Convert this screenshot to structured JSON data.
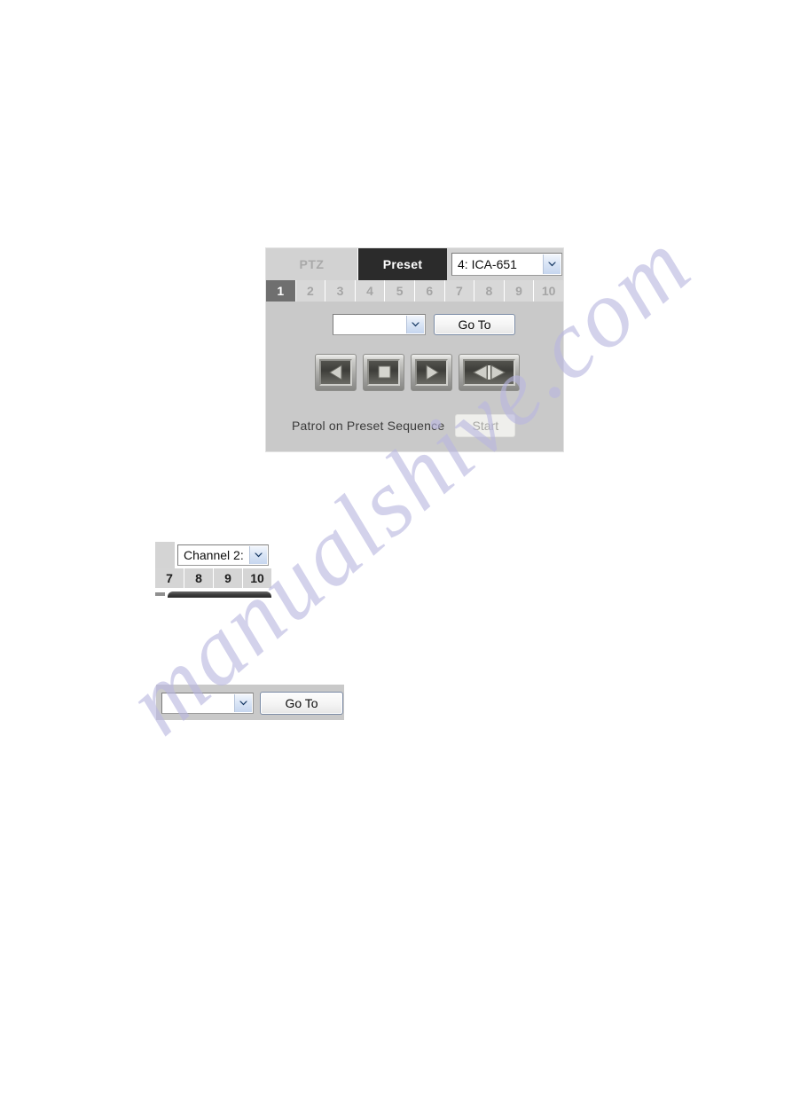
{
  "page": {
    "background_color": "#ffffff",
    "watermark_text": "manualshive.com",
    "watermark_color": "#b9b7e0"
  },
  "ptz_preset_panel": {
    "tabs": [
      {
        "label": "PTZ",
        "state": "inactive"
      },
      {
        "label": "Preset",
        "state": "active"
      }
    ],
    "camera_select": {
      "value": "4: ICA-651",
      "placeholder": "4: ICA-651"
    },
    "preset_numbers": [
      {
        "label": "1",
        "selected": true
      },
      {
        "label": "2",
        "selected": false
      },
      {
        "label": "3",
        "selected": false
      },
      {
        "label": "4",
        "selected": false
      },
      {
        "label": "5",
        "selected": false
      },
      {
        "label": "6",
        "selected": false
      },
      {
        "label": "7",
        "selected": false
      },
      {
        "label": "8",
        "selected": false
      },
      {
        "label": "9",
        "selected": false
      },
      {
        "label": "10",
        "selected": false
      }
    ],
    "preset_select": {
      "value": "",
      "placeholder": ""
    },
    "goto_button": "Go To",
    "ptz_buttons": [
      {
        "icon": "arrow-left-icon",
        "name": "pan-left-button"
      },
      {
        "icon": "stop-square-icon",
        "name": "stop-button"
      },
      {
        "icon": "arrow-right-icon",
        "name": "pan-right-button"
      },
      {
        "icon": "auto-pan-icon",
        "name": "auto-pan-button"
      }
    ],
    "patrol_label": "Patrol on Preset Sequence",
    "patrol_button": {
      "label": "Start",
      "enabled": false
    }
  },
  "channel_fragment": {
    "channel_select": {
      "value": "Channel 2:",
      "placeholder": "Channel 2:"
    },
    "numbers": [
      "7",
      "8",
      "9",
      "10"
    ]
  },
  "goto_fragment": {
    "preset_select": {
      "value": "",
      "placeholder": ""
    },
    "goto_button": "Go To"
  }
}
